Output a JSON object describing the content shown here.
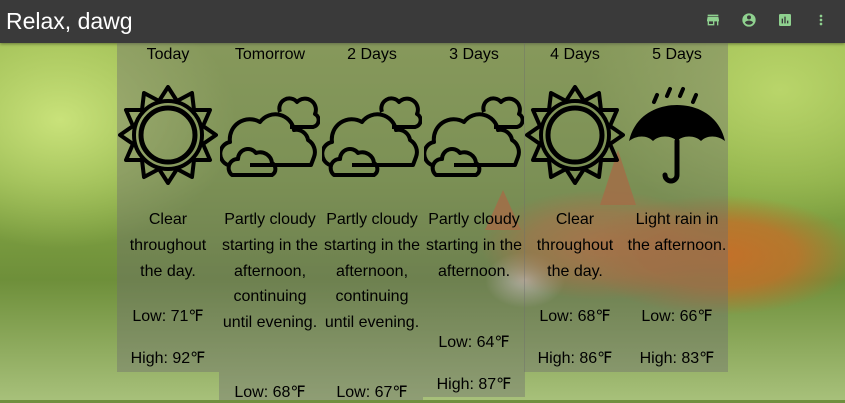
{
  "app": {
    "title": "Relax, dawg",
    "accent": "#8fd18f",
    "toolbar_icons": [
      "store-icon",
      "account-circle-icon",
      "chart-icon",
      "more-vert-icon"
    ]
  },
  "forecast": [
    {
      "day": "Today",
      "icon": "sun-icon",
      "desc": "Clear throughout the day.",
      "low": "Low: 71℉",
      "high": "High: 92℉"
    },
    {
      "day": "Tomorrow",
      "icon": "partly-cloudy-icon",
      "desc": "Partly cloudy starting in the afternoon, continuing until evening.",
      "low": "Low: 68℉",
      "high": ""
    },
    {
      "day": "2 Days",
      "icon": "partly-cloudy-icon",
      "desc": "Partly cloudy starting in the afternoon, continuing until evening.",
      "low": "Low: 67℉",
      "high": ""
    },
    {
      "day": "3 Days",
      "icon": "partly-cloudy-icon",
      "desc": "Partly cloudy starting in the afternoon.",
      "low": "Low: 64℉",
      "high": "High: 87℉"
    },
    {
      "day": "4 Days",
      "icon": "sun-icon",
      "desc": "Clear throughout the day.",
      "low": "Low: 68℉",
      "high": "High: 86℉"
    },
    {
      "day": "5 Days",
      "icon": "umbrella-rain-icon",
      "desc": "Light rain in the afternoon.",
      "low": "Low: 66℉",
      "high": "High: 83℉"
    }
  ]
}
